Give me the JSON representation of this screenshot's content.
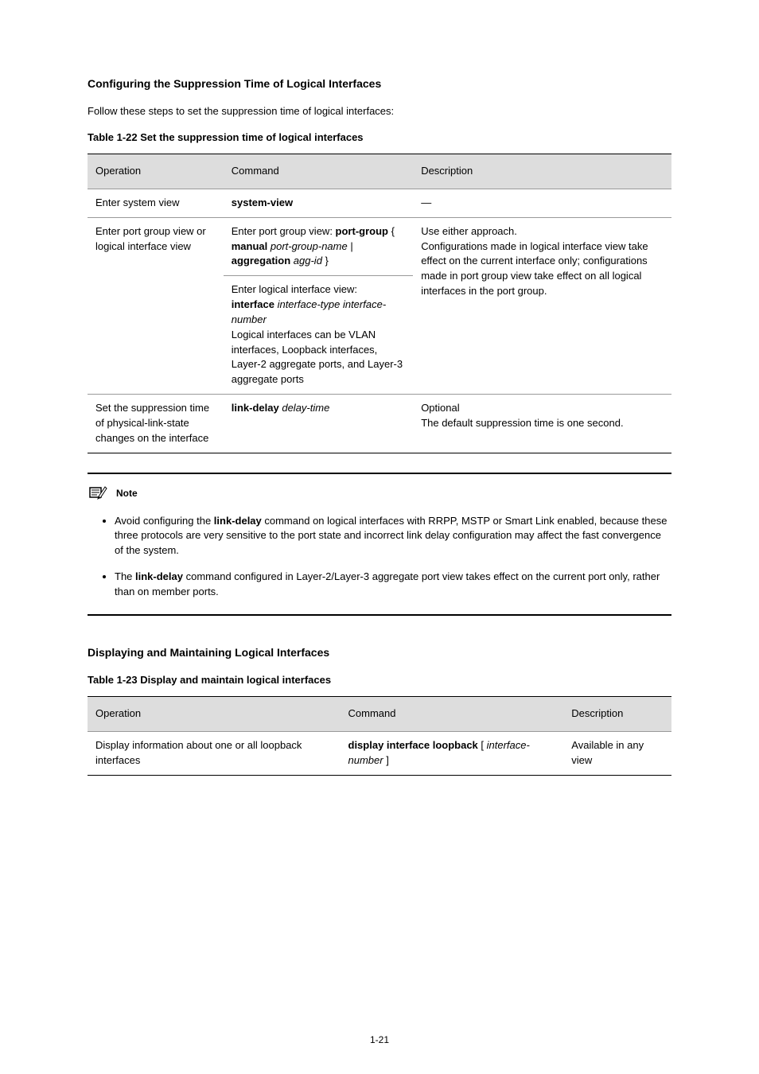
{
  "sectionA": {
    "title": "Configuring the Suppression Time of Logical Interfaces",
    "intro": "Follow these steps to set the suppression time of logical interfaces:",
    "tableCaption": "Table 1-22 Set the suppression time of logical interfaces"
  },
  "tableA": {
    "headers": [
      "Operation",
      "Command",
      "Description"
    ],
    "rows": [
      {
        "op": "Enter system view",
        "cmd": "system-view",
        "desc": "—",
        "desc_rowspan": 1
      },
      {
        "op": "Enter port group view or logical interface view",
        "op_rowspan": 2,
        "cmd_html": "Enter port group view: <span class=\"cmd\">port-group</span> { <span class=\"cmd\">manual</span> <span class=\"cmd-arg\">port-group-name</span> | <span class=\"cmd\">aggregation</span> <span class=\"cmd-arg\">agg-id</span> }",
        "desc_html": "Use either approach.<br>Configurations made in logical interface view take effect on the current interface only; configurations made in port group view take effect on all logical interfaces in the port group.",
        "desc_rowspan": 2
      },
      {
        "cmd_html": "Enter logical interface view:<br><span class=\"cmd\">interface</span> <span class=\"cmd-arg\">interface-type interface-number</span><br>Logical interfaces can be VLAN interfaces, Loopback interfaces, Layer-2 aggregate ports, and Layer-3 aggregate ports"
      },
      {
        "op": "Set the suppression time of physical-link-state changes on the interface",
        "cmd_html": "<span class=\"cmd\">link-delay</span> <span class=\"cmd-arg\">delay-time</span>",
        "desc_html": "Optional<br>The default suppression time is one second."
      }
    ]
  },
  "note": {
    "label": "Note",
    "bullets": [
      {
        "html": "Avoid configuring the <span class=\"cmd\">link-delay</span> command on logical interfaces with RRPP, MSTP or Smart Link enabled, because these three protocols are very sensitive to the port state and incorrect link delay configuration may affect the fast convergence of the system."
      },
      {
        "html": "The <span class=\"cmd\">link-delay</span> command configured in Layer-2/Layer-3 aggregate port view takes effect on the current port only, rather than on member ports."
      }
    ]
  },
  "sectionB": {
    "title": "Displaying and Maintaining Logical Interfaces",
    "tableCaption": "Table 1-23 Display and maintain logical interfaces"
  },
  "tableB": {
    "headers": [
      "Operation",
      "Command",
      "Description"
    ],
    "rows": [
      {
        "op": "Display information about one or all loopback interfaces",
        "cmd_html": "<span class=\"cmd\">display interface loopback</span> [ <span class=\"cmd-arg\">interface-number</span> ]",
        "desc": "Available in any view"
      }
    ]
  },
  "pageNumber": "1-21"
}
